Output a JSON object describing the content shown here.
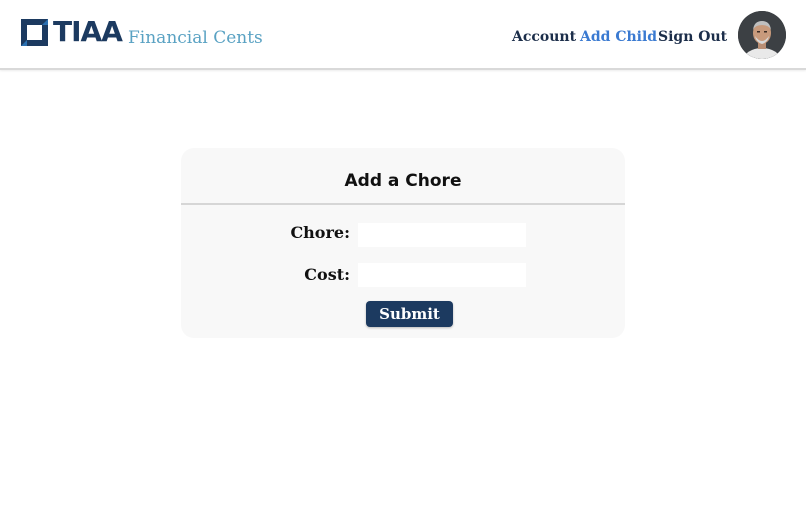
{
  "header": {
    "logo_text": "TIAA",
    "app_name": "Financial Cents",
    "nav": {
      "account": "Account",
      "add_child": "Add Child",
      "sign_out": "Sign Out"
    },
    "colors": {
      "brand": "#1c3a60",
      "app_name": "#5aa2c3",
      "active_link": "#3a7ad1"
    }
  },
  "form": {
    "title": "Add a Chore",
    "chore_label": "Chore:",
    "chore_value": "",
    "cost_label": "Cost:",
    "cost_value": "",
    "submit_label": "Submit"
  },
  "icons": {
    "logo": "tiaa-logo-icon",
    "avatar": "user-avatar"
  }
}
